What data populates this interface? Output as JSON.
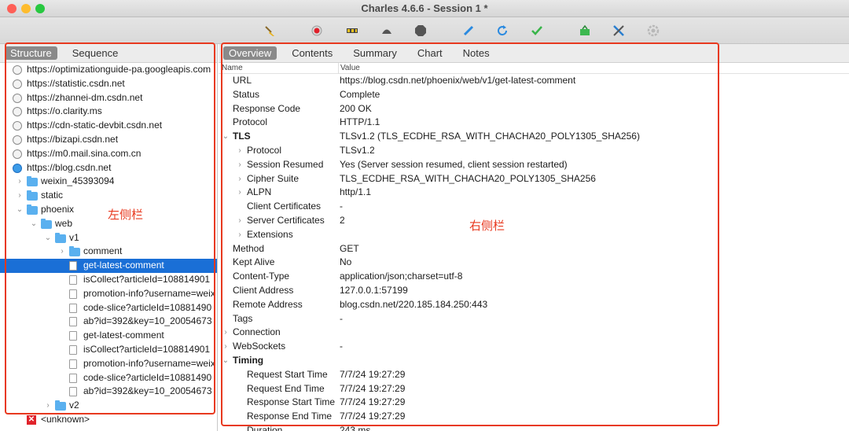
{
  "window": {
    "title": "Charles 4.6.6 - Session 1 *"
  },
  "toolbar": {
    "icons": [
      "broom-icon",
      "record-icon",
      "throttle-icon",
      "turtle-icon",
      "stop-icon",
      "pen-icon",
      "refresh-icon",
      "check-icon",
      "basket-icon",
      "tools-icon",
      "settings-icon"
    ]
  },
  "left": {
    "tabs": [
      {
        "label": "Structure",
        "active": true
      },
      {
        "label": "Sequence",
        "active": false
      }
    ],
    "tree": [
      {
        "label": "https://optimizationguide-pa.googleapis.com",
        "kind": "host",
        "depth": 0
      },
      {
        "label": "https://statistic.csdn.net",
        "kind": "host",
        "depth": 0
      },
      {
        "label": "https://zhannei-dm.csdn.net",
        "kind": "host",
        "depth": 0
      },
      {
        "label": "https://o.clarity.ms",
        "kind": "host",
        "depth": 0
      },
      {
        "label": "https://cdn-static-devbit.csdn.net",
        "kind": "host",
        "depth": 0
      },
      {
        "label": "https://bizapi.csdn.net",
        "kind": "host",
        "depth": 0
      },
      {
        "label": "https://m0.mail.sina.com.cn",
        "kind": "host",
        "depth": 0
      },
      {
        "label": "https://blog.csdn.net",
        "kind": "host-active",
        "depth": 0
      },
      {
        "label": "weixin_45393094",
        "kind": "folder",
        "depth": 1,
        "chev": "right"
      },
      {
        "label": "static",
        "kind": "folder",
        "depth": 1,
        "chev": "right"
      },
      {
        "label": "phoenix",
        "kind": "folder",
        "depth": 1,
        "chev": "down"
      },
      {
        "label": "web",
        "kind": "folder",
        "depth": 2,
        "chev": "down"
      },
      {
        "label": "v1",
        "kind": "folder",
        "depth": 3,
        "chev": "down"
      },
      {
        "label": "comment",
        "kind": "folder",
        "depth": 4,
        "chev": "right"
      },
      {
        "label": "get-latest-comment",
        "kind": "file",
        "depth": 4,
        "selected": true
      },
      {
        "label": "isCollect?articleId=108814901",
        "kind": "file",
        "depth": 4
      },
      {
        "label": "promotion-info?username=weix",
        "kind": "file",
        "depth": 4
      },
      {
        "label": "code-slice?articleId=10881490",
        "kind": "file",
        "depth": 4
      },
      {
        "label": "ab?id=392&key=10_20054673",
        "kind": "file",
        "depth": 4
      },
      {
        "label": "get-latest-comment",
        "kind": "file",
        "depth": 4
      },
      {
        "label": "isCollect?articleId=108814901",
        "kind": "file",
        "depth": 4
      },
      {
        "label": "promotion-info?username=weix",
        "kind": "file",
        "depth": 4
      },
      {
        "label": "code-slice?articleId=10881490",
        "kind": "file",
        "depth": 4
      },
      {
        "label": "ab?id=392&key=10_20054673",
        "kind": "file",
        "depth": 4
      },
      {
        "label": "v2",
        "kind": "folder",
        "depth": 3,
        "chev": "right"
      },
      {
        "label": "<unknown>",
        "kind": "unknown",
        "depth": 1
      }
    ],
    "annotation": "左侧栏"
  },
  "right": {
    "tabs": [
      {
        "label": "Overview",
        "active": true
      },
      {
        "label": "Contents",
        "active": false
      },
      {
        "label": "Summary",
        "active": false
      },
      {
        "label": "Chart",
        "active": false
      },
      {
        "label": "Notes",
        "active": false
      }
    ],
    "col_name": "Name",
    "col_value": "Value",
    "rows": [
      {
        "name": "URL",
        "value": "https://blog.csdn.net/phoenix/web/v1/get-latest-comment",
        "indent": 0
      },
      {
        "name": "Status",
        "value": "Complete",
        "indent": 0
      },
      {
        "name": "Response Code",
        "value": "200 OK",
        "indent": 0
      },
      {
        "name": "Protocol",
        "value": "HTTP/1.1",
        "indent": 0
      },
      {
        "name": "TLS",
        "value": "TLSv1.2 (TLS_ECDHE_RSA_WITH_CHACHA20_POLY1305_SHA256)",
        "indent": 0,
        "chev": "down",
        "bold": true
      },
      {
        "name": "Protocol",
        "value": "TLSv1.2",
        "indent": 1,
        "chev": "right"
      },
      {
        "name": "Session Resumed",
        "value": "Yes (Server session resumed, client session restarted)",
        "indent": 1,
        "chev": "right"
      },
      {
        "name": "Cipher Suite",
        "value": "TLS_ECDHE_RSA_WITH_CHACHA20_POLY1305_SHA256",
        "indent": 1,
        "chev": "right"
      },
      {
        "name": "ALPN",
        "value": "http/1.1",
        "indent": 1,
        "chev": "right"
      },
      {
        "name": "Client Certificates",
        "value": "-",
        "indent": 1
      },
      {
        "name": "Server Certificates",
        "value": "2",
        "indent": 1,
        "chev": "right"
      },
      {
        "name": "Extensions",
        "value": "",
        "indent": 1,
        "chev": "right"
      },
      {
        "name": "Method",
        "value": "GET",
        "indent": 0
      },
      {
        "name": "Kept Alive",
        "value": "No",
        "indent": 0
      },
      {
        "name": "Content-Type",
        "value": "application/json;charset=utf-8",
        "indent": 0
      },
      {
        "name": "Client Address",
        "value": "127.0.0.1:57199",
        "indent": 0
      },
      {
        "name": "Remote Address",
        "value": "blog.csdn.net/220.185.184.250:443",
        "indent": 0
      },
      {
        "name": "Tags",
        "value": "-",
        "indent": 0
      },
      {
        "name": "Connection",
        "value": "",
        "indent": 0,
        "chev": "right"
      },
      {
        "name": "WebSockets",
        "value": "-",
        "indent": 0,
        "chev": "right"
      },
      {
        "name": "Timing",
        "value": "",
        "indent": 0,
        "chev": "down",
        "bold": true
      },
      {
        "name": "Request Start Time",
        "value": "7/7/24 19:27:29",
        "indent": 1
      },
      {
        "name": "Request End Time",
        "value": "7/7/24 19:27:29",
        "indent": 1
      },
      {
        "name": "Response Start Time",
        "value": "7/7/24 19:27:29",
        "indent": 1
      },
      {
        "name": "Response End Time",
        "value": "7/7/24 19:27:29",
        "indent": 1
      },
      {
        "name": "Duration",
        "value": "243 ms",
        "indent": 1
      }
    ],
    "annotation": "右侧栏"
  },
  "colors": {
    "accent": "#1a6fd6",
    "annotation": "#e8391f",
    "folder": "#5ab0ef"
  }
}
